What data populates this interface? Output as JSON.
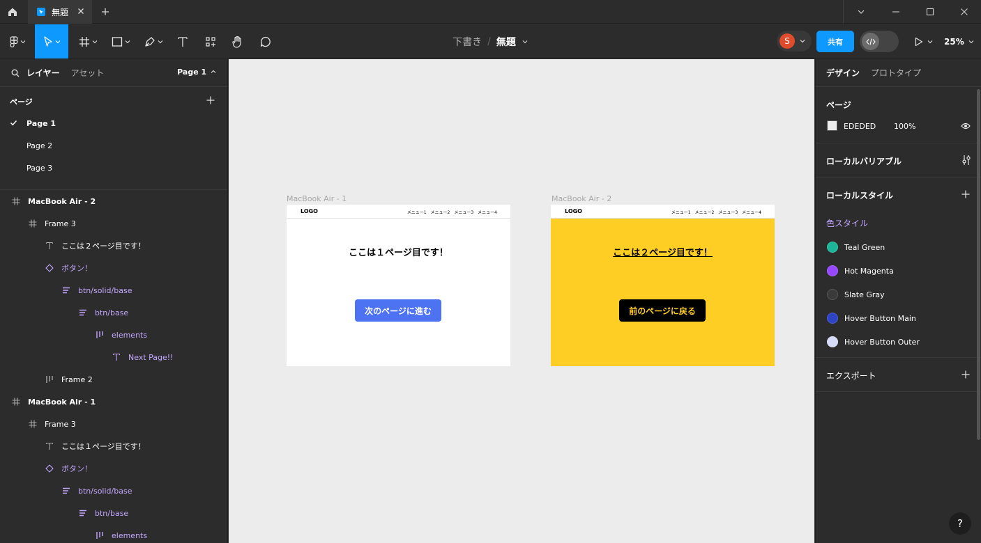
{
  "titlebar": {
    "tab_title": "無題"
  },
  "toolbar": {
    "breadcrumb_parent": "下書き",
    "breadcrumb_sep": "/",
    "file_title": "無題",
    "avatar_initial": "S",
    "share_label": "共有",
    "zoom": "25%"
  },
  "left_panel": {
    "tab_layers": "レイヤー",
    "tab_assets": "アセット",
    "page_selector": "Page 1",
    "pages_title": "ページ",
    "pages": [
      "Page 1",
      "Page 2",
      "Page 3"
    ],
    "current_page": "Page 1",
    "layers": [
      {
        "label": "MacBook Air - 2",
        "icon": "frame-icon",
        "indent": 0,
        "bold": true,
        "purple": false
      },
      {
        "label": "Frame 3",
        "icon": "frame-icon",
        "indent": 1,
        "bold": false,
        "purple": false
      },
      {
        "label": "ここは２ページ目です！",
        "icon": "text-icon",
        "indent": 2,
        "bold": false,
        "purple": false
      },
      {
        "label": "ボタン！",
        "icon": "instance-icon",
        "indent": 2,
        "bold": false,
        "purple": true
      },
      {
        "label": "btn/solid/base",
        "icon": "autolayout-vertical-icon",
        "indent": 3,
        "bold": false,
        "purple": true
      },
      {
        "label": "btn/base",
        "icon": "autolayout-vertical-icon",
        "indent": 4,
        "bold": false,
        "purple": true
      },
      {
        "label": "elements",
        "icon": "autolayout-horizontal-icon",
        "indent": 5,
        "bold": false,
        "purple": true
      },
      {
        "label": "Next Page!!",
        "icon": "text-icon",
        "indent": 6,
        "bold": false,
        "purple": true
      },
      {
        "label": "Frame 2",
        "icon": "autolayout-horizontal-icon",
        "indent": 2,
        "bold": false,
        "purple": false
      },
      {
        "label": "MacBook Air - 1",
        "icon": "frame-icon",
        "indent": 0,
        "bold": true,
        "purple": false
      },
      {
        "label": "Frame 3",
        "icon": "frame-icon",
        "indent": 1,
        "bold": false,
        "purple": false
      },
      {
        "label": "ここは１ページ目です！",
        "icon": "text-icon",
        "indent": 2,
        "bold": false,
        "purple": false
      },
      {
        "label": "ボタン！",
        "icon": "instance-icon",
        "indent": 2,
        "bold": false,
        "purple": true
      },
      {
        "label": "btn/solid/base",
        "icon": "autolayout-vertical-icon",
        "indent": 3,
        "bold": false,
        "purple": true
      },
      {
        "label": "btn/base",
        "icon": "autolayout-vertical-icon",
        "indent": 4,
        "bold": false,
        "purple": true
      },
      {
        "label": "elements",
        "icon": "autolayout-horizontal-icon",
        "indent": 5,
        "bold": false,
        "purple": true
      }
    ]
  },
  "canvas": {
    "frame1": {
      "label": "MacBook Air - 1",
      "logo": "LOGO",
      "menus": [
        "メニュー1",
        "メニュー2",
        "メニュー3",
        "メニュー4"
      ],
      "heading": "ここは１ページ目です！",
      "button": "次のページに進む",
      "bg": "#ffffff",
      "button_bg": "#4d72f2",
      "button_color": "#ffffff"
    },
    "frame2": {
      "label": "MacBook Air - 2",
      "logo": "LOGO",
      "menus": [
        "メニュー1",
        "メニュー2",
        "メニュー3",
        "メニュー4"
      ],
      "heading": "ここは２ページ目です！",
      "button": "前のページに戻る",
      "bg": "#ffce25",
      "button_bg": "#000000",
      "button_color": "#ffce25"
    }
  },
  "right_panel": {
    "tab_design": "デザイン",
    "tab_prototype": "プロトタイプ",
    "page_section_title": "ページ",
    "page_bg_hex": "EDEDED",
    "page_bg_opacity": "100%",
    "local_variables_title": "ローカルバリアブル",
    "local_styles_title": "ローカルスタイル",
    "color_styles_title": "色スタイル",
    "color_styles": [
      {
        "name": "Teal Green",
        "color": "#1bb69a"
      },
      {
        "name": "Hot Magenta",
        "color": "#9747ff"
      },
      {
        "name": "Slate Gray",
        "color": "#3a3a3a"
      },
      {
        "name": "Hover Button Main",
        "color": "#2d44c4"
      },
      {
        "name": "Hover Button Outer",
        "color": "#d6dcf7"
      }
    ],
    "export_title": "エクスポート"
  },
  "help": "?"
}
